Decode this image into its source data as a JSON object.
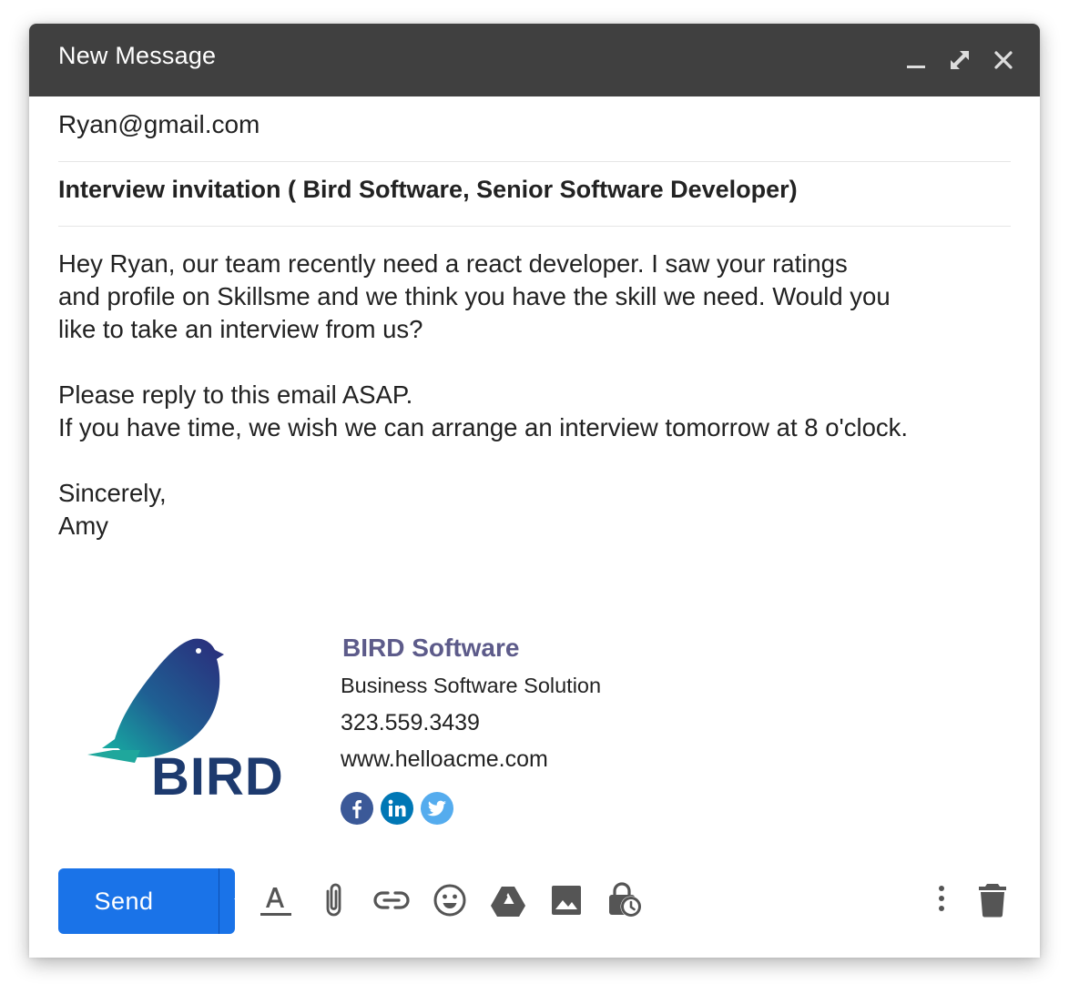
{
  "window": {
    "title": "New Message"
  },
  "titlebar_icons": [
    "minimize-icon",
    "expand-icon",
    "close-icon"
  ],
  "recipient": {
    "value": "Ryan@gmail.com"
  },
  "subject": {
    "value": "Interview invitation ( Bird Software, Senior Software Developer)"
  },
  "body": {
    "lines": [
      "Hey Ryan, our team recently need a react developer. I saw your ratings",
      "and profile on Skillsme and we think you have the skill we need. Would you",
      "like to take an interview from us?",
      "Please reply to this email ASAP.",
      "If you have time, we wish we can arrange an interview tomorrow at 8 o'clock.",
      "Sincerely,",
      "Amy"
    ]
  },
  "signature": {
    "logo_text": "BIRD",
    "company": "BIRD Software",
    "tagline": "Business Software Solution",
    "phone": "323.559.3439",
    "website": "www.helloacme.com",
    "social": [
      "facebook-icon",
      "linkedin-icon",
      "twitter-icon"
    ]
  },
  "toolbar": {
    "send_label": "Send",
    "tools": [
      "text-format-icon",
      "attach-icon",
      "link-icon",
      "emoji-icon",
      "drive-icon",
      "image-icon",
      "schedule-lock-icon",
      "more-options-icon",
      "trash-icon"
    ]
  },
  "colors": {
    "titlebar": "#404040",
    "send_button": "#1a73e8",
    "company_name": "#5d5b8a",
    "logo_text": "#1d3a6e",
    "facebook": "#3b5998",
    "linkedin": "#0077b5",
    "twitter": "#55acee"
  }
}
